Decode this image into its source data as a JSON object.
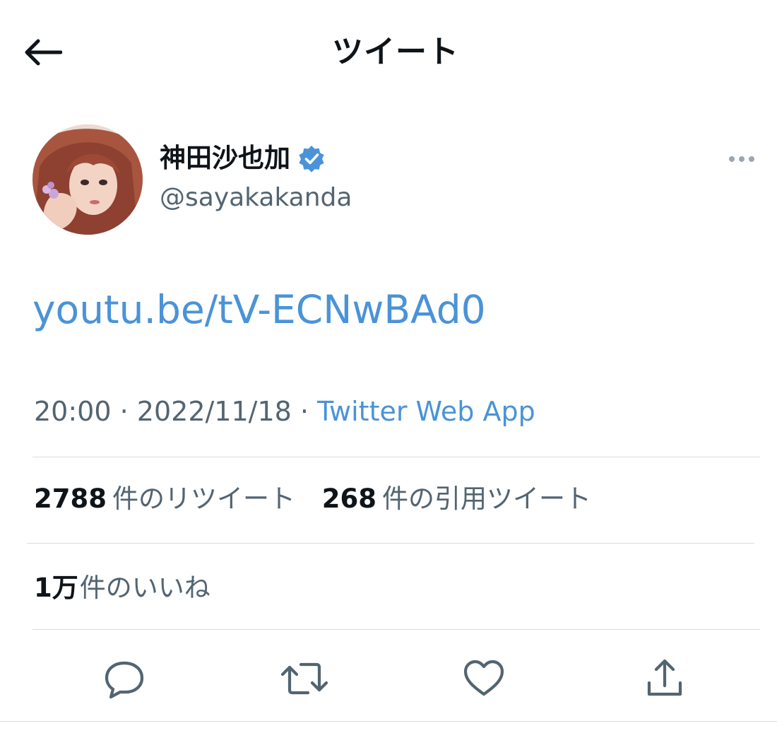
{
  "header": {
    "title": "ツイート",
    "back_icon": "arrow-left-icon"
  },
  "author": {
    "display_name": "神田沙也加",
    "handle": "@sayakakanda",
    "verified_icon": "verified-badge-icon",
    "more_icon": "more-horizontal-icon"
  },
  "tweet": {
    "link_text": "youtu.be/tV-ECNwBAd0",
    "time": "20:00",
    "separator": "·",
    "date": "2022/11/18",
    "source": "Twitter Web App"
  },
  "stats": {
    "retweets_count": "2788",
    "retweets_label": "件のリツイート",
    "quotes_count": "268",
    "quotes_label": "件の引用ツイート",
    "likes_count": "1万",
    "likes_label": "件のいいね"
  },
  "actions": [
    {
      "name": "reply",
      "icon": "reply-icon"
    },
    {
      "name": "retweet",
      "icon": "retweet-icon"
    },
    {
      "name": "like",
      "icon": "heart-icon"
    },
    {
      "name": "share",
      "icon": "share-icon"
    }
  ],
  "colors": {
    "link": "#4a93d8",
    "text": "#0f1419",
    "secondary_text": "#536471",
    "verified": "#4a93d8",
    "divider": "#d8dde1",
    "icon": "#536471"
  }
}
